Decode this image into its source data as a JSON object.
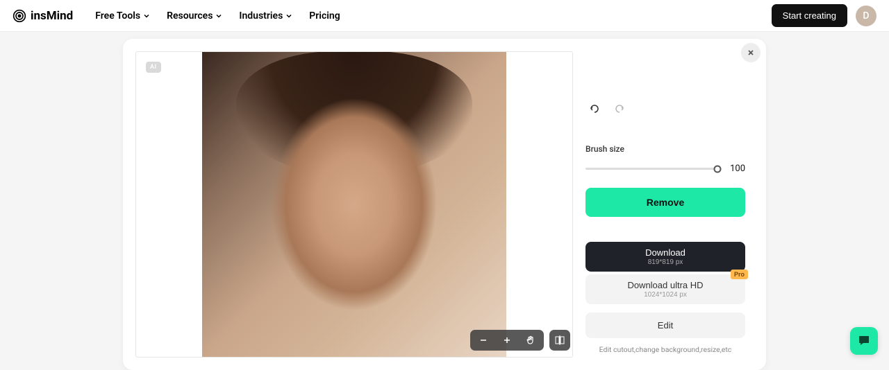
{
  "header": {
    "brand": "insMind",
    "nav": {
      "free_tools": "Free Tools",
      "resources": "Resources",
      "industries": "Industries",
      "pricing": "Pricing"
    },
    "start_creating": "Start creating",
    "avatar_initial": "D"
  },
  "canvas": {
    "ai_badge": "AI"
  },
  "sidebar": {
    "brush_label": "Brush size",
    "brush_value": "100",
    "remove_label": "Remove",
    "download": {
      "title": "Download",
      "sub": "819*819 px"
    },
    "download_hd": {
      "title": "Download ultra HD",
      "sub": "1024*1024 px",
      "pro": "Pro"
    },
    "edit_label": "Edit",
    "edit_hint": "Edit cutout,change background,resize,etc"
  }
}
